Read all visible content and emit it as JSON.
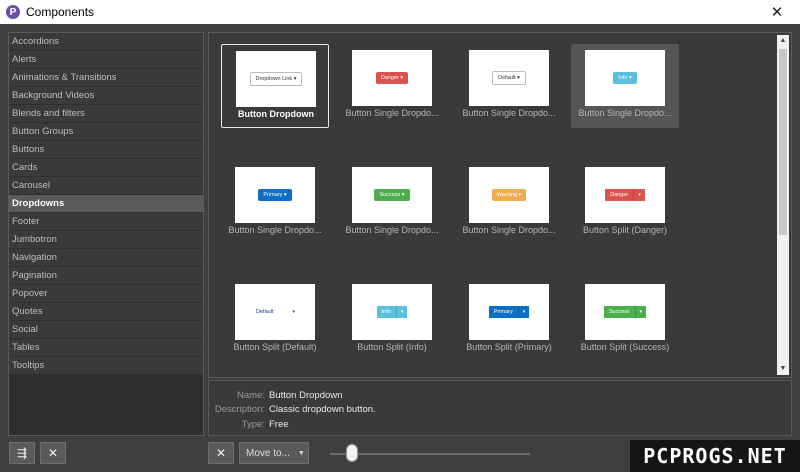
{
  "window": {
    "title": "Components",
    "app_icon": "P",
    "close_glyph": "✕"
  },
  "sidebar": {
    "items": [
      {
        "label": "Accordions"
      },
      {
        "label": "Alerts"
      },
      {
        "label": "Animations & Transitions"
      },
      {
        "label": "Background Videos"
      },
      {
        "label": "Blends and filters"
      },
      {
        "label": "Button Groups"
      },
      {
        "label": "Buttons"
      },
      {
        "label": "Cards"
      },
      {
        "label": "Carousel"
      },
      {
        "label": "Dropdowns",
        "selected": true
      },
      {
        "label": "Footer"
      },
      {
        "label": "Jumbotron"
      },
      {
        "label": "Navigation"
      },
      {
        "label": "Pagination"
      },
      {
        "label": "Popover"
      },
      {
        "label": "Quotes"
      },
      {
        "label": "Social"
      },
      {
        "label": "Tables"
      },
      {
        "label": "Tooltips"
      }
    ]
  },
  "tiles": [
    {
      "label": "Button Dropdown",
      "preview": "Dropdown Link ▾"
    },
    {
      "label": "Button Single Dropdo...",
      "preview": "Danger ▾"
    },
    {
      "label": "Button Single Dropdo...",
      "preview": "Default ▾"
    },
    {
      "label": "Button Single Dropdo...",
      "preview": "Info ▾"
    },
    {
      "label": "Button Single Dropdo...",
      "preview": "Primary ▾"
    },
    {
      "label": "Button Single Dropdo...",
      "preview": "Success ▾"
    },
    {
      "label": "Button Single Dropdo...",
      "preview": "Warning ▾"
    },
    {
      "label": "Button Split (Danger)",
      "preview": "Danger"
    },
    {
      "label": "Button Split (Default)",
      "preview": "Default"
    },
    {
      "label": "Button Split (Info)",
      "preview": "Info"
    },
    {
      "label": "Button Split (Primary)",
      "preview": "Primary"
    },
    {
      "label": "Button Split (Success)",
      "preview": "Success"
    }
  ],
  "colors": {
    "danger": "#d9534f",
    "info": "#5bc0de",
    "primary": "#0b6fc4",
    "success": "#4cae4c",
    "warning": "#f0ad4e"
  },
  "details": {
    "name_key": "Name:",
    "name_value": "Button Dropdown",
    "desc_key": "Description:",
    "desc_value": "Classic dropdown button.",
    "type_key": "Type:",
    "type_value": "Free"
  },
  "bottombar": {
    "move_to_label": "Move to...",
    "dropdown_arrow": "▼",
    "add_icon": "⇶",
    "remove_icon": "✕",
    "watermark": "PCPROGS.NET"
  },
  "scroll": {
    "up": "▲",
    "down": "▼"
  }
}
